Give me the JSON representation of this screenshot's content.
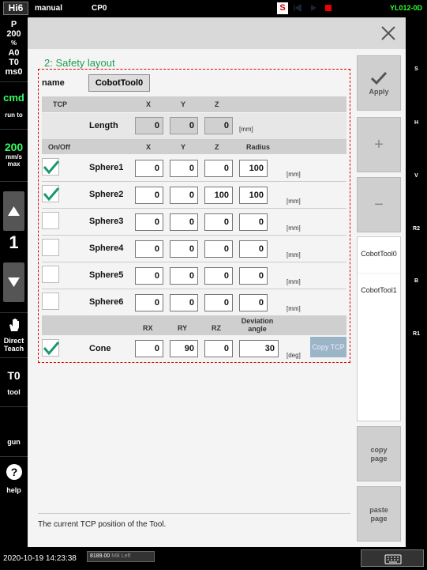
{
  "topbar": {
    "controller": "Hi6",
    "mode": "manual",
    "program": "CP0",
    "servo_indicator": "S",
    "robot_id": "YL012-0D"
  },
  "left": {
    "p_label": "P",
    "speed_pct": "200",
    "pct_sign": "%",
    "a_value": "A0",
    "t_value": "T0",
    "ms_value": "ms0",
    "cmd_label": "cmd",
    "run_to_label": "run to",
    "speed_value": "200",
    "speed_unit1": "mm/s",
    "speed_unit2": "max",
    "step_value": "1",
    "direct_teach1": "Direct",
    "direct_teach2": "Teach",
    "tool_value": "T0",
    "tool_label": "tool",
    "gun_label": "gun",
    "help_label": "help"
  },
  "rightaxis": {
    "items": [
      "S",
      "H",
      "V",
      "R2",
      "B",
      "R1"
    ]
  },
  "main": {
    "title": "2: Safety layout",
    "name_label": "name",
    "name_value": "CobotTool0",
    "tcp_header": {
      "tcp": "TCP",
      "x": "X",
      "y": "Y",
      "z": "Z"
    },
    "length_label": "Length",
    "length_values": [
      "0",
      "0",
      "0"
    ],
    "length_unit": "[mm]",
    "sphere_header": {
      "onoff": "On/Off",
      "x": "X",
      "y": "Y",
      "z": "Z",
      "radius": "Radius"
    },
    "spheres": [
      {
        "label": "Sphere1",
        "checked": true,
        "x": "0",
        "y": "0",
        "z": "0",
        "r": "100",
        "unit": "[mm]"
      },
      {
        "label": "Sphere2",
        "checked": true,
        "x": "0",
        "y": "0",
        "z": "100",
        "r": "100",
        "unit": "[mm]"
      },
      {
        "label": "Sphere3",
        "checked": false,
        "x": "0",
        "y": "0",
        "z": "0",
        "r": "0",
        "unit": "[mm]"
      },
      {
        "label": "Sphere4",
        "checked": false,
        "x": "0",
        "y": "0",
        "z": "0",
        "r": "0",
        "unit": "[mm]"
      },
      {
        "label": "Sphere5",
        "checked": false,
        "x": "0",
        "y": "0",
        "z": "0",
        "r": "0",
        "unit": "[mm]"
      },
      {
        "label": "Sphere6",
        "checked": false,
        "x": "0",
        "y": "0",
        "z": "0",
        "r": "0",
        "unit": "[mm]"
      }
    ],
    "cone_header": {
      "rx": "RX",
      "ry": "RY",
      "rz": "RZ",
      "dev1": "Deviation",
      "dev2": "angle"
    },
    "cone": {
      "label": "Cone",
      "checked": true,
      "rx": "0",
      "ry": "90",
      "rz": "0",
      "angle": "30",
      "unit": "[deg]"
    },
    "copy_tcp": "Copy TCP",
    "status_text": "The current TCP position of the Tool."
  },
  "sidebuttons": {
    "apply": "Apply",
    "plus": "+",
    "minus": "−",
    "tools": [
      "CobotTool0",
      "CobotTool1"
    ],
    "copy1": "copy",
    "copy2": "page",
    "paste1": "paste",
    "paste2": "page"
  },
  "bottombar": {
    "datetime": "2020-10-19 14:23:38",
    "memory": "8189.00",
    "memory_suffix": "MB Left"
  },
  "colors": {
    "accent_green": "#1aa050",
    "panel_border": "#dd0000",
    "robot_id_color": "#33ff33"
  }
}
